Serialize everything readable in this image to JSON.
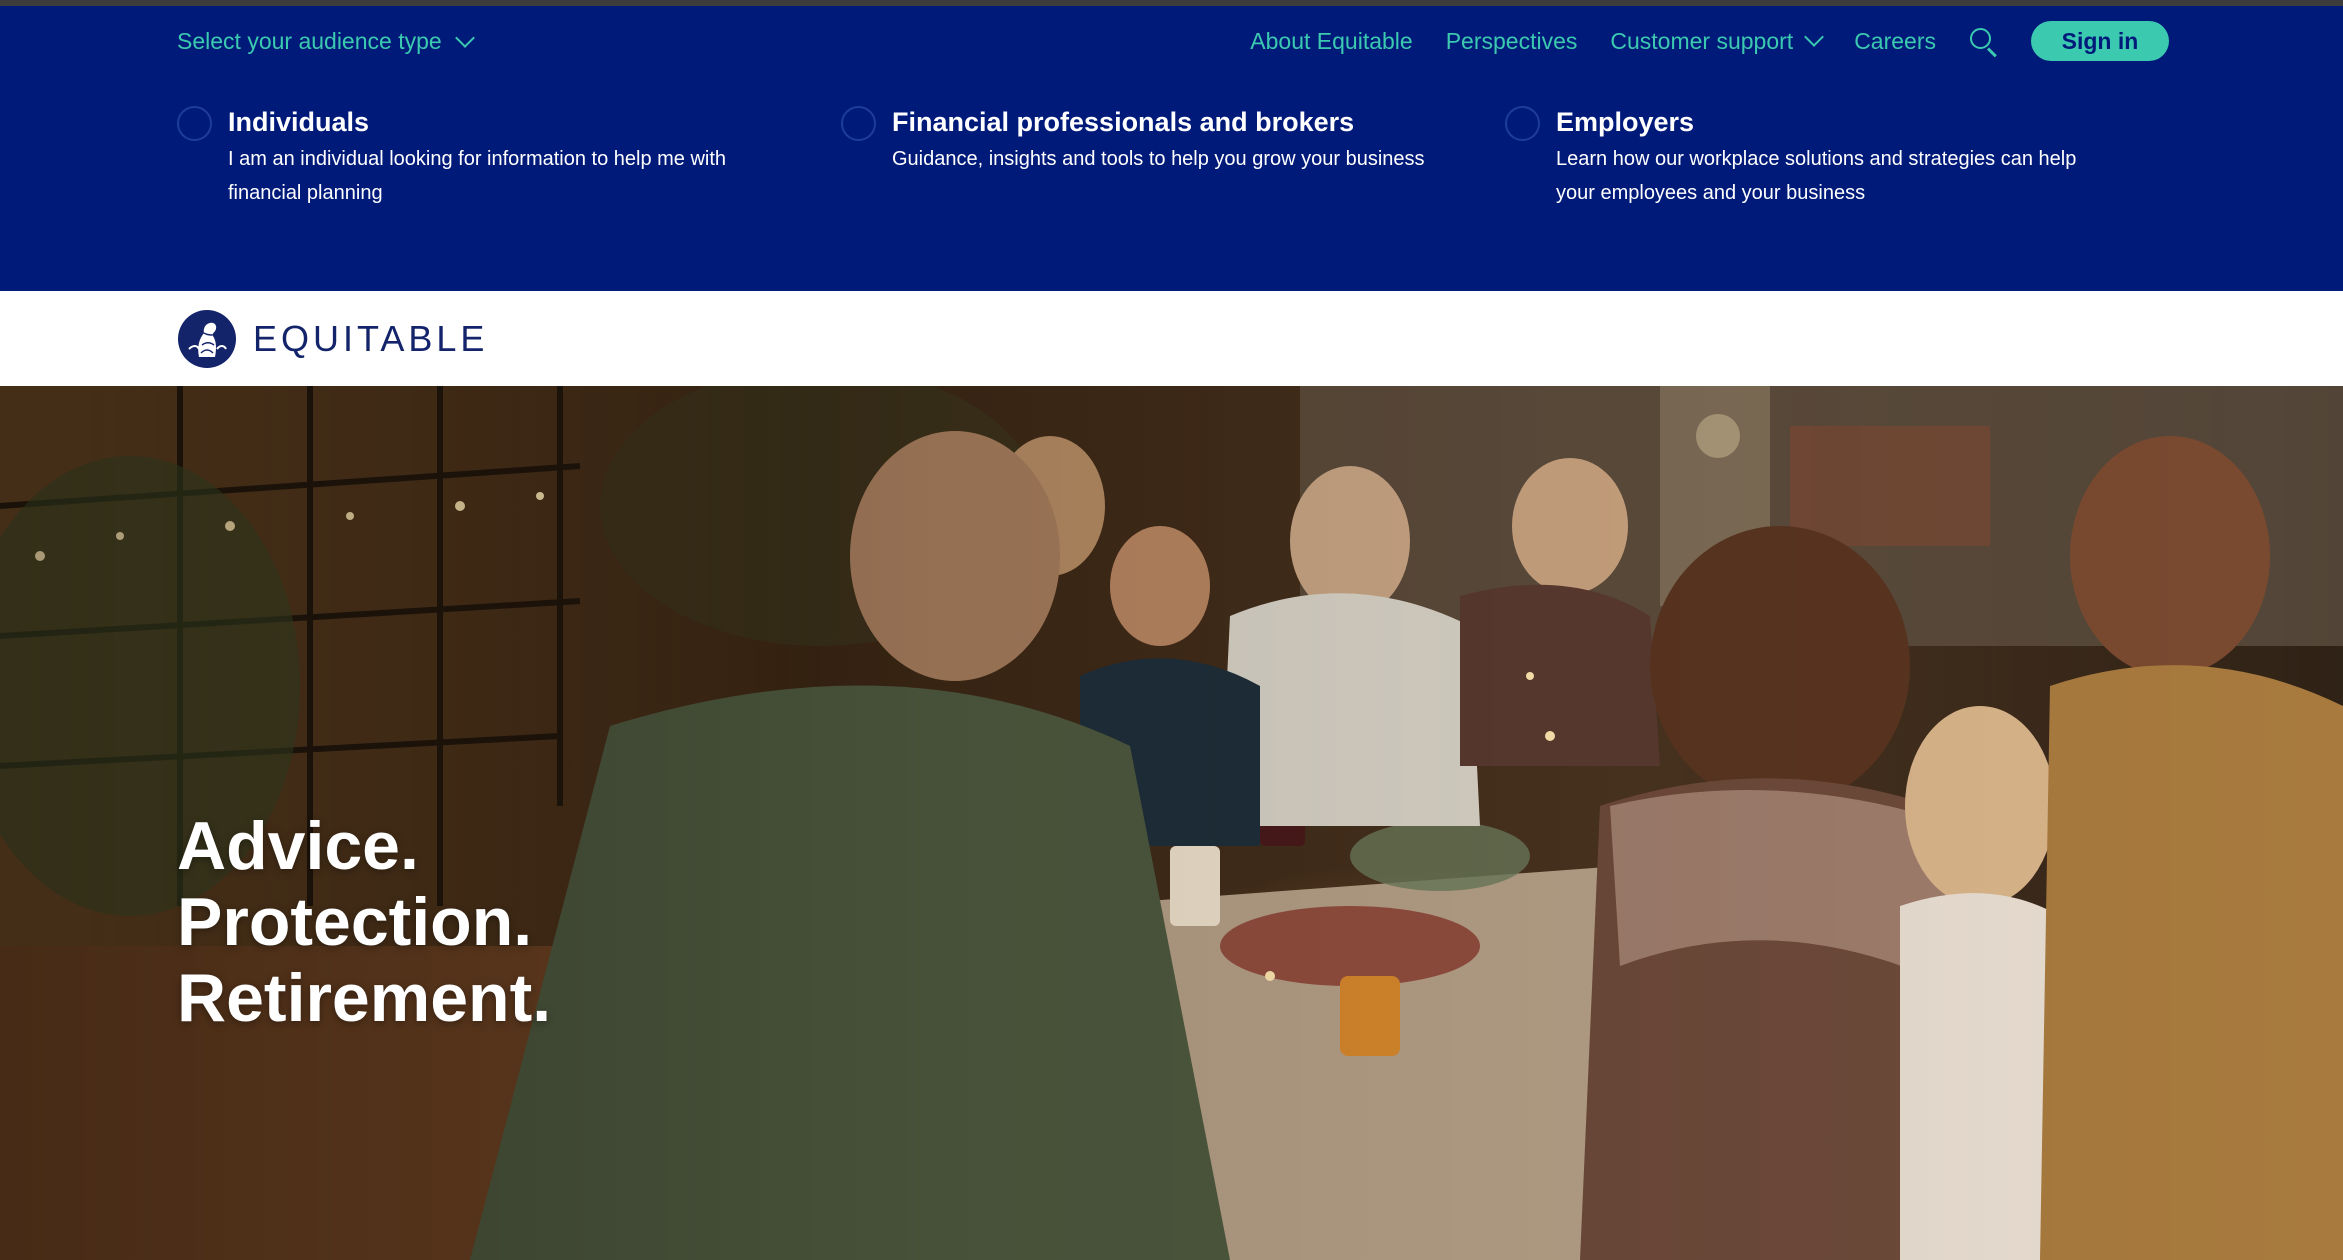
{
  "audience": {
    "select_label": "Select your audience type",
    "options": [
      {
        "title": "Individuals",
        "description_line1": "I am an individual looking for information to help me with",
        "description_line2": "financial planning"
      },
      {
        "title": "Financial professionals and brokers",
        "description_line1": "Guidance, insights and tools to help you grow your business",
        "description_line2": ""
      },
      {
        "title": "Employers",
        "description_line1": "Learn how our workplace solutions and strategies can help",
        "description_line2": "your employees and your business"
      }
    ]
  },
  "nav": {
    "about": "About Equitable",
    "perspectives": "Perspectives",
    "customer_support": "Customer support",
    "careers": "Careers",
    "search_icon": "search-icon",
    "sign_in": "Sign in"
  },
  "brand": {
    "name": "EQUITABLE"
  },
  "hero": {
    "headline": [
      "Advice.",
      "Protection.",
      "Retirement."
    ],
    "image": "family-dinner-photo"
  },
  "colors": {
    "navy": "#001a7a",
    "teal": "#3bc9b0",
    "logo_navy": "#14246b"
  }
}
